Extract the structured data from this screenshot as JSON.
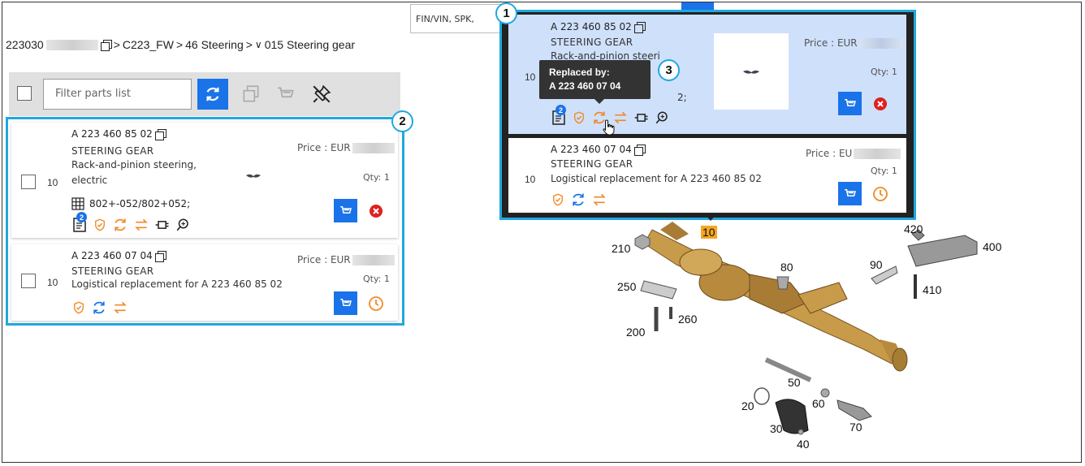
{
  "breadcrumb": {
    "vin_prefix": "223030",
    "model": "C223_FW",
    "group": "46 Steering",
    "sub": "015 Steering gear",
    "sep": ">",
    "chevron": "∨"
  },
  "toolbar": {
    "filter_placeholder": "Filter parts list"
  },
  "search_strip": {
    "text": "FIN/VIN, SPK,"
  },
  "parts": [
    {
      "position": "10",
      "number": "A 223 460 85 02",
      "name": "STEERING GEAR",
      "desc_line1": "Rack-and-pinion steering,",
      "desc_line2": "electric",
      "variant": "802+-052/802+052;",
      "price_label": "Price : EUR",
      "qty": "Qty: 1",
      "badge": "2"
    },
    {
      "position": "10",
      "number": "A 223 460 07 04",
      "name": "STEERING GEAR",
      "desc": "Logistical replacement for A 223 460 85 02",
      "price_label": "Price : EUR",
      "qty": "Qty: 1"
    }
  ],
  "popup": {
    "card1": {
      "position": "10",
      "number": "A 223 460 85 02",
      "name": "STEERING GEAR",
      "desc_partial": "Rack-and-pinion steeri",
      "variant_tail": "2;",
      "price_label": "Price : EUR",
      "qty": "Qty: 1",
      "badge": "2"
    },
    "card2": {
      "position": "10",
      "number": "A 223 460 07 04",
      "name": "STEERING GEAR",
      "desc": "Logistical replacement for A 223 460 85 02",
      "price_label": "Price : EU",
      "qty": "Qty: 1"
    },
    "tooltip": {
      "title": "Replaced by:",
      "value": "A 223 460 07 04"
    }
  },
  "callouts": [
    "1",
    "2",
    "3"
  ],
  "diagram_labels": {
    "l10": "10",
    "l20": "20",
    "l30": "30",
    "l40": "40",
    "l50": "50",
    "l60": "60",
    "l70": "70",
    "l80": "80",
    "l90": "90",
    "l200": "200",
    "l210": "210",
    "l250": "250",
    "l260": "260",
    "l400": "400",
    "l410": "410",
    "l420": "420"
  },
  "colors": {
    "accent_blue": "#1a73e8",
    "callout_border": "#1fa8df",
    "orange_icon": "#f08a24",
    "remove_red": "#e02020",
    "popup_bg": "#222222",
    "highlight_card": "#cfe0fb",
    "part_gold": "#c89b4a"
  },
  "icons": [
    "copy-icon",
    "refresh-icon",
    "cart-icon",
    "unpin-icon",
    "document-icon",
    "shield-check-icon",
    "swap-icon",
    "connector-icon",
    "magnify-icon",
    "remove-icon",
    "clock-icon",
    "grid-icon"
  ]
}
